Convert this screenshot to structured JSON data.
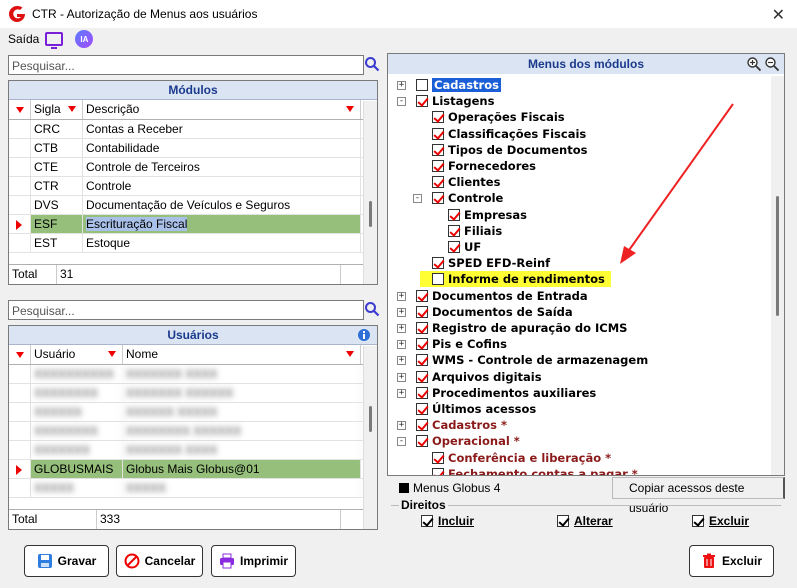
{
  "window": {
    "title": "CTR - Autorização de Menus aos usuários",
    "close_glyph": "✕"
  },
  "topbar": {
    "saida_label": "Saída",
    "ia_label": "IA"
  },
  "modulos": {
    "search_placeholder": "Pesquisar...",
    "title": "Módulos",
    "col_sigla": "Sigla",
    "col_descricao": "Descrição",
    "rows": [
      {
        "sigla": "CRC",
        "descricao": "Contas a Receber"
      },
      {
        "sigla": "CTB",
        "descricao": "Contabilidade"
      },
      {
        "sigla": "CTE",
        "descricao": "Controle de Terceiros"
      },
      {
        "sigla": "CTR",
        "descricao": "Controle"
      },
      {
        "sigla": "DVS",
        "descricao": "Documentação de Veículos e Seguros"
      },
      {
        "sigla": "ESF",
        "descricao": "Escrituração Fiscal"
      },
      {
        "sigla": "EST",
        "descricao": "Estoque"
      }
    ],
    "total_label": "Total",
    "total_value": "31"
  },
  "usuarios": {
    "search_placeholder": "Pesquisar...",
    "title": "Usuários",
    "col_usuario": "Usuário",
    "col_nome": "Nome",
    "rows": [
      {
        "usuario": "XXXXXXXXXX",
        "nome": "XXXXXXX XXXX"
      },
      {
        "usuario": "XXXXXXXX",
        "nome": "XXXXXXX XXXXXX"
      },
      {
        "usuario": "XXXXXX",
        "nome": "XXXXXX XXXXX"
      },
      {
        "usuario": "XXXXXXXX",
        "nome": "XXXXXXXX XXXXXX"
      },
      {
        "usuario": "XXXXXXX",
        "nome": "XXXXXXX XXXX"
      },
      {
        "usuario": "GLOBUSMAIS",
        "nome": "Globus Mais Globus@01"
      },
      {
        "usuario": "XXXXX",
        "nome": "XXXXX"
      }
    ],
    "total_label": "Total",
    "total_value": "333"
  },
  "menus": {
    "title": "Menus dos módulos",
    "nodes": [
      {
        "label": "Cadastros",
        "expander": "+",
        "checked": false
      },
      {
        "label": "Listagens",
        "expander": "-",
        "checked": true
      },
      {
        "label": "Operações Fiscais",
        "checked": true
      },
      {
        "label": "Classificações Fiscais",
        "checked": true
      },
      {
        "label": "Tipos de Documentos",
        "checked": true
      },
      {
        "label": "Fornecedores",
        "checked": true
      },
      {
        "label": "Clientes",
        "checked": true
      },
      {
        "label": "Controle",
        "expander": "-",
        "checked": true
      },
      {
        "label": "Empresas",
        "checked": true
      },
      {
        "label": "Filiais",
        "checked": true
      },
      {
        "label": "UF",
        "checked": true
      },
      {
        "label": "SPED EFD-Reinf",
        "checked": true
      },
      {
        "label": "Informe de rendimentos",
        "checked": false
      },
      {
        "label": "Documentos de Entrada",
        "expander": "+",
        "checked": true
      },
      {
        "label": "Documentos de Saída",
        "expander": "+",
        "checked": true
      },
      {
        "label": "Registro de apuração do ICMS",
        "expander": "+",
        "checked": true
      },
      {
        "label": "Pis e Cofins",
        "expander": "+",
        "checked": true
      },
      {
        "label": "WMS - Controle de armazenagem",
        "expander": "+",
        "checked": true
      },
      {
        "label": "Arquivos digitais",
        "expander": "+",
        "checked": true
      },
      {
        "label": "Procedimentos auxiliares",
        "expander": "+",
        "checked": true
      },
      {
        "label": "Últimos acessos",
        "checked": true
      },
      {
        "label": "Cadastros *",
        "expander": "+",
        "checked": true
      },
      {
        "label": "Operacional *",
        "expander": "-",
        "checked": true
      },
      {
        "label": "Conferência e liberação *",
        "checked": true
      },
      {
        "label": "Fechamento contas a pagar *",
        "checked": true
      }
    ],
    "legend_label": "Menus Globus 4",
    "copy_button": "Copiar acessos deste usuário"
  },
  "direitos": {
    "legend": "Direitos",
    "incluir": "Incluir",
    "alterar": "Alterar",
    "excluir": "Excluir"
  },
  "buttons": {
    "gravar": "Gravar",
    "cancelar": "Cancelar",
    "imprimir": "Imprimir",
    "excluir": "Excluir"
  },
  "colors": {
    "accent": "#1a3a8c",
    "selected_row": "#95bf7a",
    "selected_highlight": "#a9c1e8",
    "tree_selected": "#1b5fd6",
    "highlight_yellow": "#ffff33",
    "check_red": "#e00000"
  }
}
